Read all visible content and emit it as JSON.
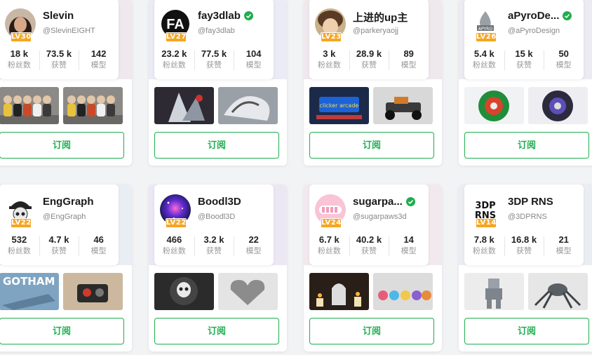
{
  "stat_labels": {
    "fans": "粉丝数",
    "likes": "获赞",
    "models": "模型"
  },
  "subscribe_label": "订阅",
  "colors": {
    "accent": "#1fae4f",
    "level_badge": "#f5a623"
  },
  "creators": [
    {
      "name": "Slevin",
      "handle": "@SlevinEIGHT",
      "level": "LV30",
      "verified": false,
      "fans": "18 k",
      "likes": "73.5 k",
      "models": "142",
      "avatar_icon": "woman-portrait-avatar",
      "thumb_icons": [
        "figurines-group-photo",
        "figurines-group-photo"
      ]
    },
    {
      "name": "fay3dlab",
      "handle": "@fay3dlab",
      "level": "LV27",
      "verified": true,
      "fans": "23.2 k",
      "likes": "77.5 k",
      "models": "104",
      "avatar_icon": "fa-logo-avatar",
      "thumb_icons": [
        "dark-sculpture-photo",
        "grey-sculpture-photo"
      ]
    },
    {
      "name": "上进的up主",
      "handle": "@parkeryaojj",
      "level": "LV23",
      "verified": false,
      "fans": "3 k",
      "likes": "28.9 k",
      "models": "89",
      "avatar_icon": "anime-character-avatar",
      "thumb_icons": [
        "arcade-display-photo",
        "rc-car-photo"
      ]
    },
    {
      "name": "aPyroDe...",
      "handle": "@aPyroDesign",
      "level": "LV26",
      "verified": true,
      "fans": "5.4 k",
      "likes": "15 k",
      "models": "50",
      "avatar_icon": "flame-logo-avatar",
      "thumb_icons": [
        "green-gear-photo",
        "purple-gear-photo"
      ]
    },
    {
      "name": "EngGraph",
      "handle": "@EngGraph",
      "level": "LV22",
      "verified": false,
      "fans": "532",
      "likes": "4.7 k",
      "models": "46",
      "avatar_icon": "cap-skull-avatar",
      "thumb_icons": [
        "gotham-model-photo",
        "robot-desk-photo"
      ]
    },
    {
      "name": "Boodl3D",
      "handle": "@Boodl3D",
      "level": "LV22",
      "verified": false,
      "fans": "466",
      "likes": "3.2 k",
      "models": "22",
      "avatar_icon": "galaxy-avatar",
      "thumb_icons": [
        "skull-carving-photo",
        "heart-box-photo"
      ]
    },
    {
      "name": "sugarpa...",
      "handle": "@sugarpaws3d",
      "level": "LV24",
      "verified": true,
      "fans": "6.7 k",
      "likes": "40.2 k",
      "models": "14",
      "avatar_icon": "pink-smile-avatar",
      "thumb_icons": [
        "ghost-candles-photo",
        "toy-figures-photo"
      ]
    },
    {
      "name": "3DP RNS",
      "handle": "@3DPRNS",
      "level": "LV14",
      "verified": false,
      "fans": "7.8 k",
      "likes": "16.8 k",
      "models": "21",
      "avatar_icon": "text-logo-avatar",
      "avatar_text": [
        "3DP",
        "RNS"
      ],
      "thumb_icons": [
        "robot-figure-photo",
        "spider-robot-photo"
      ]
    }
  ],
  "thumb_texts": {
    "gotham": "GOTHAM",
    "arcade": "clicker arcade"
  }
}
